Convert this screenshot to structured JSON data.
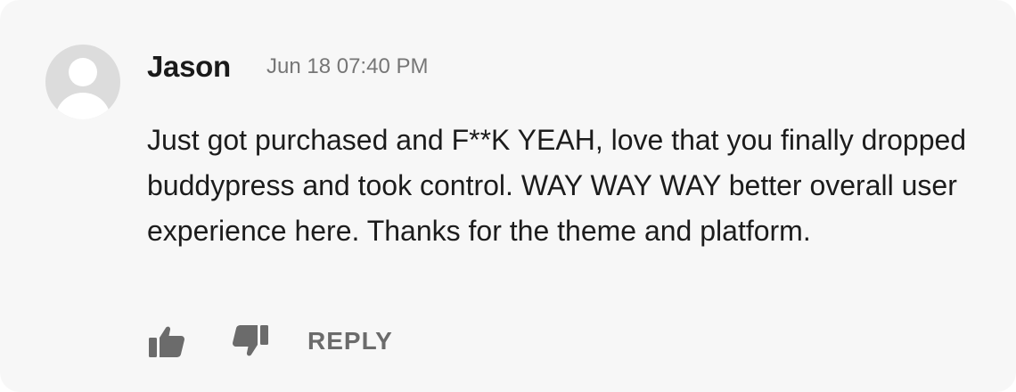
{
  "comment": {
    "author": "Jason",
    "timestamp": "Jun 18 07:40 PM",
    "body": "Just got purchased and F**K YEAH, love that you finally dropped buddypress and took control. WAY WAY WAY better overall user experience here. Thanks for the theme and platform."
  },
  "actions": {
    "like_icon": "thumbs-up-icon",
    "dislike_icon": "thumbs-down-icon",
    "reply_label": "REPLY"
  },
  "colors": {
    "card_background": "#f7f7f7",
    "avatar_background": "#dcdcdc",
    "avatar_figure": "#ffffff",
    "icon_color": "#6b6b6b",
    "text_color": "#1c1c1c",
    "meta_color": "#767676"
  }
}
